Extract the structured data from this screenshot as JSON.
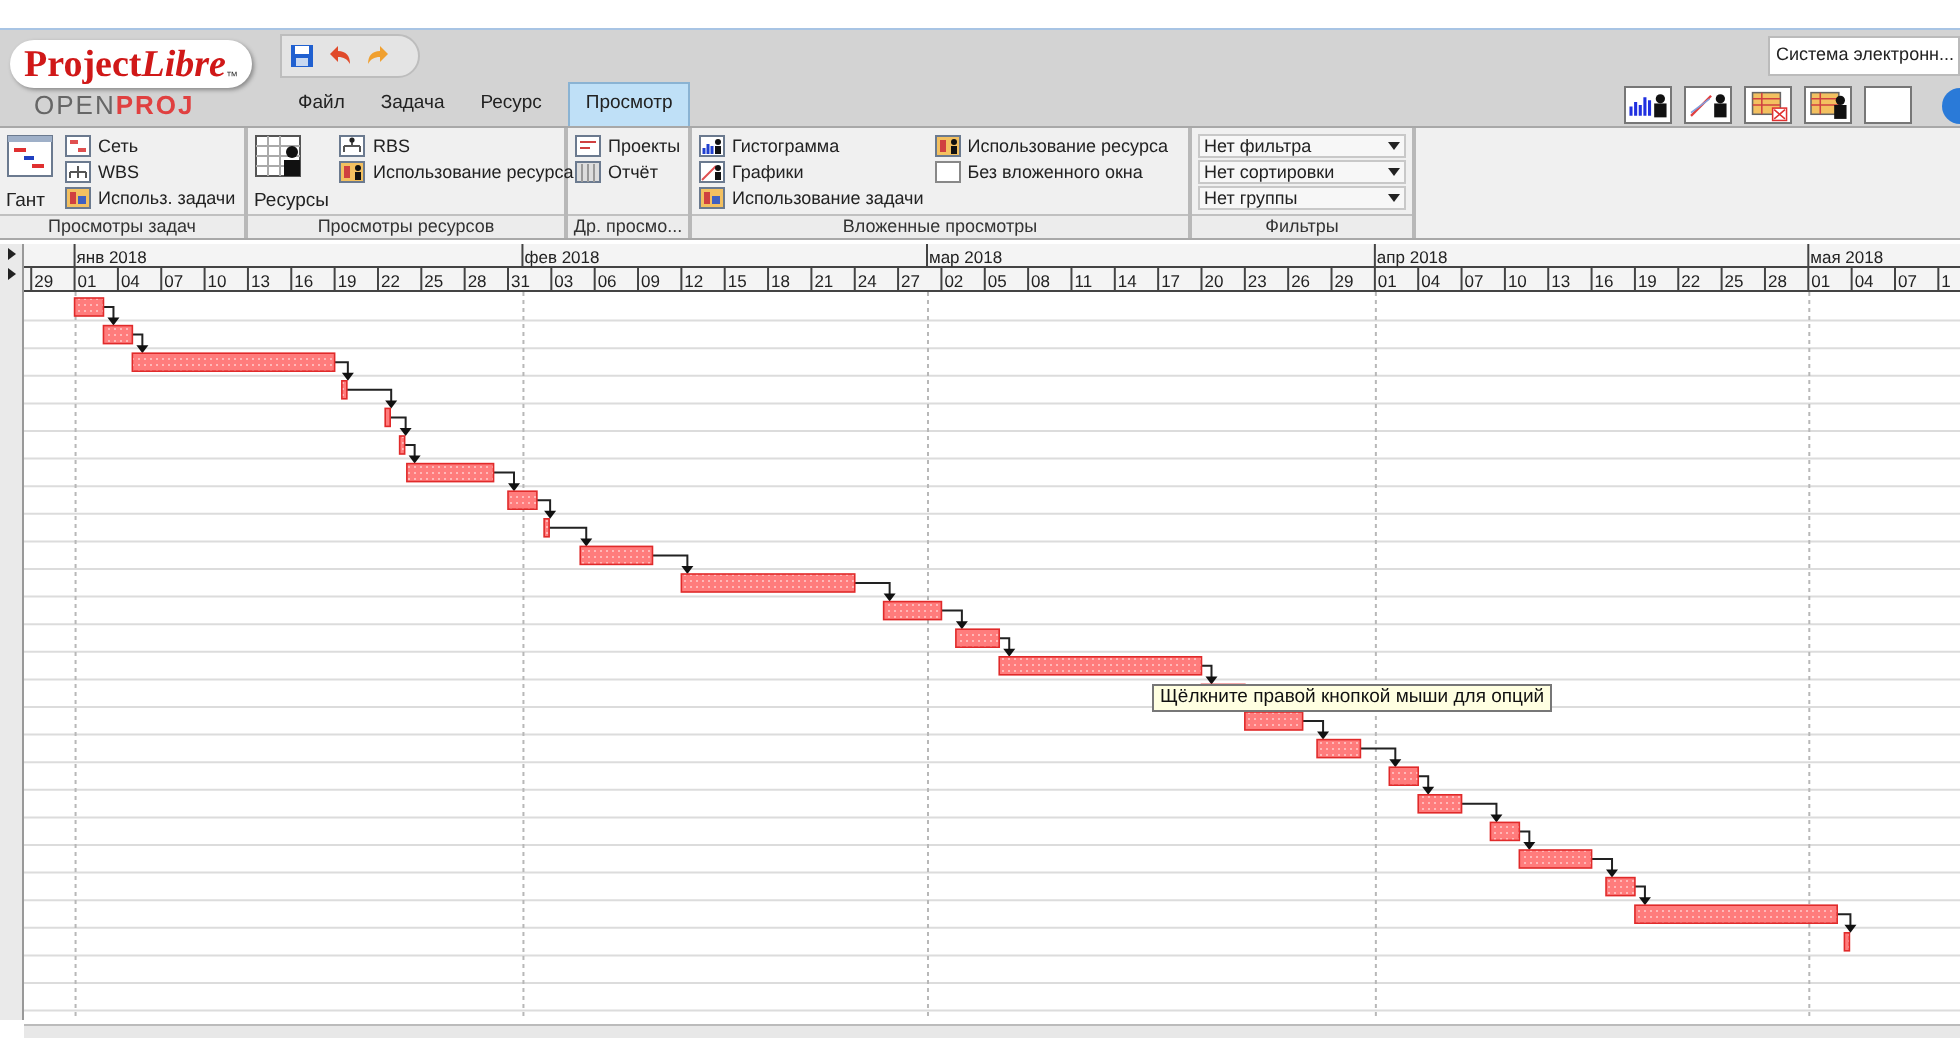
{
  "logo": {
    "brand_regular": "Project",
    "brand_italic": "Libre",
    "trademark": "™",
    "subtitle_left": "OPEN",
    "subtitle_right": "PROJ"
  },
  "menu_tabs": [
    {
      "label": "Файл",
      "selected": false
    },
    {
      "label": "Задача",
      "selected": false
    },
    {
      "label": "Ресурс",
      "selected": false
    },
    {
      "label": "Просмотр",
      "selected": true
    }
  ],
  "project_selector": {
    "value": "Система электронн..."
  },
  "ribbon_groups": [
    {
      "kind": "views",
      "title": "Просмотры задач",
      "large": "Гант",
      "columns": [
        [
          "Сеть",
          "WBS",
          "Использ. задачи"
        ]
      ]
    },
    {
      "kind": "views",
      "title": "Просмотры ресурсов",
      "large": "Ресурсы",
      "columns": [
        [
          "RBS",
          "Использование ресурса"
        ]
      ]
    },
    {
      "kind": "views",
      "title": "Др. просмо...",
      "columns": [
        [
          "Проекты",
          "Отчёт"
        ]
      ]
    },
    {
      "kind": "views",
      "title": "Вложенные просмотры",
      "columns": [
        [
          "Гистограмма",
          "Графики",
          "Использование задачи"
        ],
        [
          "Использование ресурса",
          "Без вложенного окна"
        ]
      ]
    },
    {
      "kind": "filters",
      "title": "Фильтры",
      "dropdowns": [
        "Нет фильтра",
        "Нет сортировки",
        "Нет группы"
      ]
    }
  ],
  "timescale": {
    "months": [
      "янв 2018",
      "фев 2018",
      "мар 2018",
      "апр 2018",
      "мая 2018"
    ],
    "day_ticks": [
      "29",
      "01",
      "04",
      "07",
      "10",
      "13",
      "16",
      "19",
      "22",
      "25",
      "28",
      "31",
      "03",
      "06",
      "09",
      "12",
      "15",
      "18",
      "21",
      "24",
      "27",
      "02",
      "05",
      "08",
      "11",
      "14",
      "17",
      "20",
      "23",
      "26",
      "29",
      "01",
      "04",
      "07",
      "10",
      "13",
      "16",
      "19",
      "22",
      "25",
      "28",
      "01",
      "04",
      "07",
      "1"
    ]
  },
  "tooltip": {
    "text": "Щёлкните правой кнопкой мыши для опций"
  }
}
